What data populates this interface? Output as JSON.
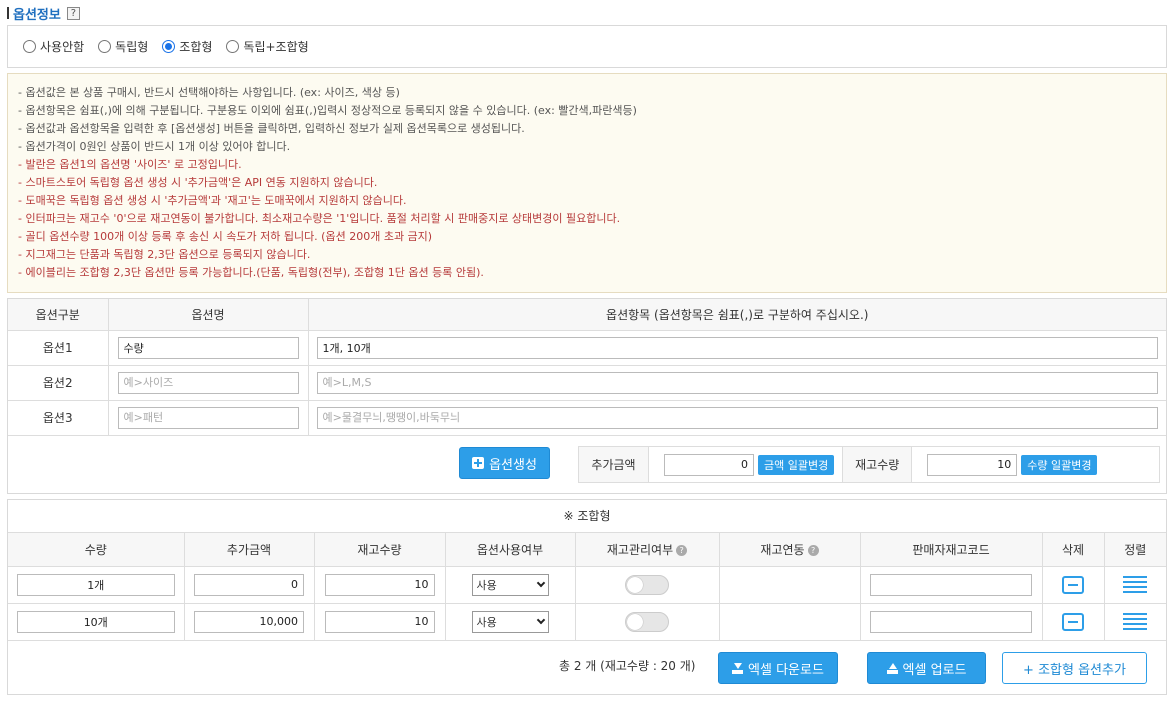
{
  "section": {
    "title": "옵션정보",
    "help": "?"
  },
  "option_type": {
    "options": [
      "사용안함",
      "독립형",
      "조합형",
      "독립+조합형"
    ],
    "selected": "조합형"
  },
  "notice": [
    {
      "text": "- 옵션값은 본 상품 구매시, 반드시 선택해야하는 사항입니다. (ex: 사이즈, 색상 등)",
      "tone": "dk"
    },
    {
      "text": "- 옵션항목은 쉼표(,)에 의해 구분됩니다. 구분용도 이외에 쉼표(,)입력시 정상적으로 등록되지 않을 수 있습니다. (ex: 빨간색,파란색등)",
      "tone": "dk"
    },
    {
      "text": "- 옵션값과 옵션항목을 입력한 후 [옵션생성] 버튼을 클릭하면, 입력하신 정보가 실제 옵션목록으로 생성됩니다.",
      "tone": "dk"
    },
    {
      "text": "- 옵션가격이 0원인 상품이 반드시 1개 이상 있어야 합니다.",
      "tone": "dk"
    },
    {
      "text": "- 발란은 옵션1의 옵션명 '사이즈' 로 고정입니다.",
      "tone": "rd"
    },
    {
      "text": "- 스마트스토어 독립형 옵션 생성 시 '추가금액'은 API 연동 지원하지 않습니다.",
      "tone": "rd"
    },
    {
      "text": "- 도매꾹은 독립형 옵션 생성 시 '추가금액'과 '재고'는 도매꾹에서 지원하지 않습니다.",
      "tone": "rd"
    },
    {
      "text": "- 인터파크는 재고수 '0'으로 재고연동이 불가합니다. 최소재고수량은 '1'입니다. 품절 처리할 시 판매중지로 상태변경이 필요합니다.",
      "tone": "rd"
    },
    {
      "text": "- 골디 옵션수량 100개 이상 등록 후 송신 시 속도가 저하 됩니다. (옵션 200개 초과 금지)",
      "tone": "rd"
    },
    {
      "text": "- 지그재그는 단품과 독립형 2,3단 옵션으로 등록되지 않습니다.",
      "tone": "rd"
    },
    {
      "text": "- 에이블리는 조합형 2,3단 옵션만 등록 가능합니다.(단품, 독립형(전부), 조합형 1단 옵션 등록 안됨).",
      "tone": "rd"
    }
  ],
  "option_table": {
    "headers": [
      "옵션구분",
      "옵션명",
      "옵션항목 (옵션항목은 쉼표(,)로 구분하여 주십시오.)"
    ],
    "rows": [
      {
        "label": "옵션1",
        "name_value": "수량",
        "name_placeholder": "",
        "items_value": "1개, 10개",
        "items_placeholder": ""
      },
      {
        "label": "옵션2",
        "name_value": "",
        "name_placeholder": "예>사이즈",
        "items_value": "",
        "items_placeholder": "예>L,M,S"
      },
      {
        "label": "옵션3",
        "name_value": "",
        "name_placeholder": "예>패턴",
        "items_value": "",
        "items_placeholder": "예>물결무늬,땡땡이,바둑무늬"
      }
    ]
  },
  "generate_button": "옵션생성",
  "bulk": {
    "price_label": "추가금액",
    "price_value": "0",
    "price_button": "금액 일괄변경",
    "stock_label": "재고수량",
    "stock_value": "10",
    "stock_button": "수량 일괄변경"
  },
  "combo": {
    "title": "※ 조합형",
    "headers": [
      "수량",
      "추가금액",
      "재고수량",
      "옵션사용여부",
      "재고관리여부",
      "재고연동",
      "판매자재고코드",
      "삭제",
      "정렬"
    ],
    "rows": [
      {
        "qty": "1개",
        "price": "0",
        "stock": "10",
        "use": "사용",
        "code": ""
      },
      {
        "qty": "10개",
        "price": "10,000",
        "stock": "10",
        "use": "사용",
        "code": ""
      }
    ],
    "total_text": "총 2 개  (재고수량 : 20 개)",
    "excel_download": "엑셀 다운로드",
    "excel_upload": "엑셀 업로드",
    "add_option": "+ 조합형 옵션추가"
  }
}
